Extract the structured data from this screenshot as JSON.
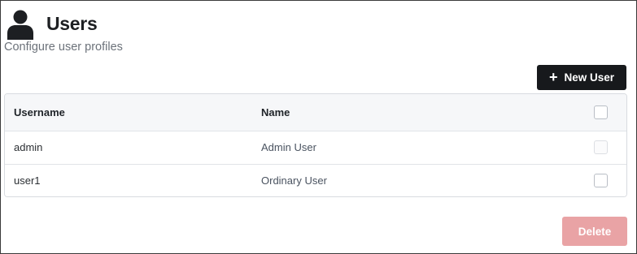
{
  "header": {
    "icon": "user-icon",
    "title": "Users",
    "subtitle": "Configure user profiles"
  },
  "toolbar": {
    "new_user_label": "New User",
    "new_user_icon": "plus-icon"
  },
  "table": {
    "columns": [
      "Username",
      "Name"
    ],
    "rows": [
      {
        "username": "admin",
        "name": "Admin User",
        "checkbox_enabled": false
      },
      {
        "username": "user1",
        "name": "Ordinary User",
        "checkbox_enabled": true
      }
    ]
  },
  "footer": {
    "delete_label": "Delete",
    "delete_enabled": false
  },
  "colors": {
    "primary_button": "#17191c",
    "delete_disabled": "#e9a3a5",
    "subtitle_text": "#6c727a"
  }
}
